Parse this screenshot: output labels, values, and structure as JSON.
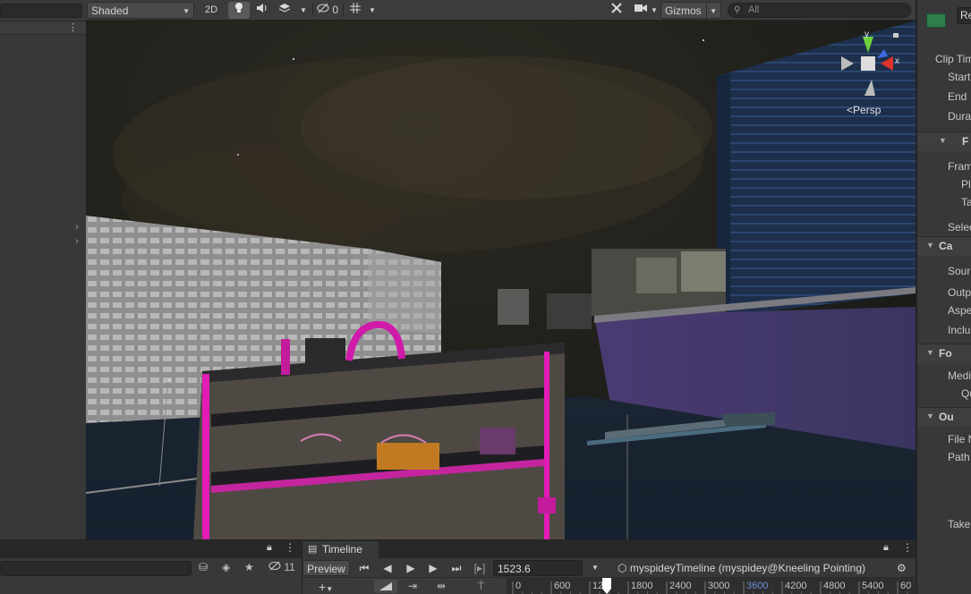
{
  "scene_toolbar": {
    "shading_mode": "Shaded",
    "mode_2d": "2D",
    "hidden_count": "0",
    "gizmos_label": "Gizmos",
    "search_placeholder": "All"
  },
  "scene_view": {
    "projection_label": "Persp",
    "gizmo_axes": {
      "y": "y",
      "x": "x"
    }
  },
  "inspector": {
    "name_field": "Re",
    "rows": [
      {
        "label": "Clip Tim",
        "indent": 0
      },
      {
        "label": "Start",
        "indent": 1
      },
      {
        "label": "End",
        "indent": 1
      },
      {
        "label": "Dura",
        "indent": 1
      },
      {
        "label": "Fram",
        "indent": 1
      },
      {
        "label": "Pl",
        "indent": 2
      },
      {
        "label": "Ta",
        "indent": 2
      },
      {
        "label": "Selec",
        "indent": 1
      },
      {
        "label": "Sour",
        "indent": 1
      },
      {
        "label": "Outp",
        "indent": 1
      },
      {
        "label": "Aspe",
        "indent": 1
      },
      {
        "label": "Inclu",
        "indent": 1
      },
      {
        "label": "Medi",
        "indent": 1
      },
      {
        "label": "Qu",
        "indent": 2
      },
      {
        "label": "File N",
        "indent": 1
      },
      {
        "label": "Path",
        "indent": 1
      },
      {
        "label": "Take",
        "indent": 1
      }
    ],
    "sections": [
      {
        "label": "F"
      },
      {
        "label": "Ca"
      },
      {
        "label": "Fo"
      },
      {
        "label": "Ou"
      }
    ]
  },
  "hierarchy_bottom": {
    "hidden_count": "11"
  },
  "timeline": {
    "tab_label": "Timeline",
    "preview_label": "Preview",
    "current_frame": "1523.6",
    "asset_label": "myspideyTimeline (myspidey@Kneeling Pointing)",
    "ruler_ticks": [
      "0",
      "600",
      "120",
      "1800",
      "2400",
      "3000",
      "3600",
      "4200",
      "4800",
      "5400",
      "60"
    ]
  },
  "colors": {
    "neon_pink": "#e21bb5",
    "building_blue": "#1c2e4a",
    "timeline_playhead": "#ffffff"
  }
}
